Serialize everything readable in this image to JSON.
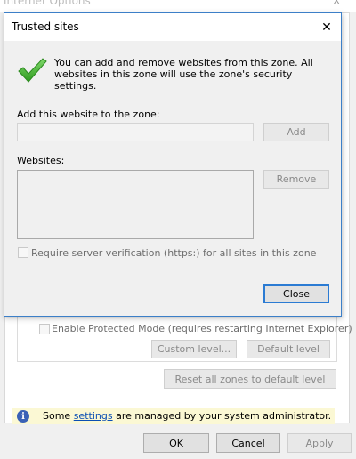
{
  "internet_options": {
    "title": "Internet Options",
    "close_glyph": "X",
    "protected_mode_label": "Enable Protected Mode (requires restarting Internet Explorer)",
    "custom_level_label": "Custom level...",
    "default_level_label": "Default level",
    "reset_zones_label": "Reset all zones to default level",
    "info": {
      "prefix": "Some ",
      "link": "settings",
      "suffix": " are managed by your system administrator.",
      "icon": "info-icon"
    },
    "buttons": {
      "ok": "OK",
      "cancel": "Cancel",
      "apply": "Apply"
    }
  },
  "trusted_sites": {
    "title": "Trusted sites",
    "close_glyph": "✕",
    "icon": "checkmark-icon",
    "intro": "You can add and remove websites from this zone. All websites in this zone will use the zone's security settings.",
    "add_label": "Add this website to the zone:",
    "add_value": "",
    "add_button": "Add",
    "websites_label": "Websites:",
    "websites": [],
    "remove_button": "Remove",
    "verify_label": "Require server verification (https:) for all sites in this zone",
    "close_button": "Close"
  },
  "colors": {
    "accent": "#2b7bd3",
    "dialog_border": "#3c7fc8",
    "check_green": "#3fae2a",
    "info_bar": "#fbf8d4"
  }
}
